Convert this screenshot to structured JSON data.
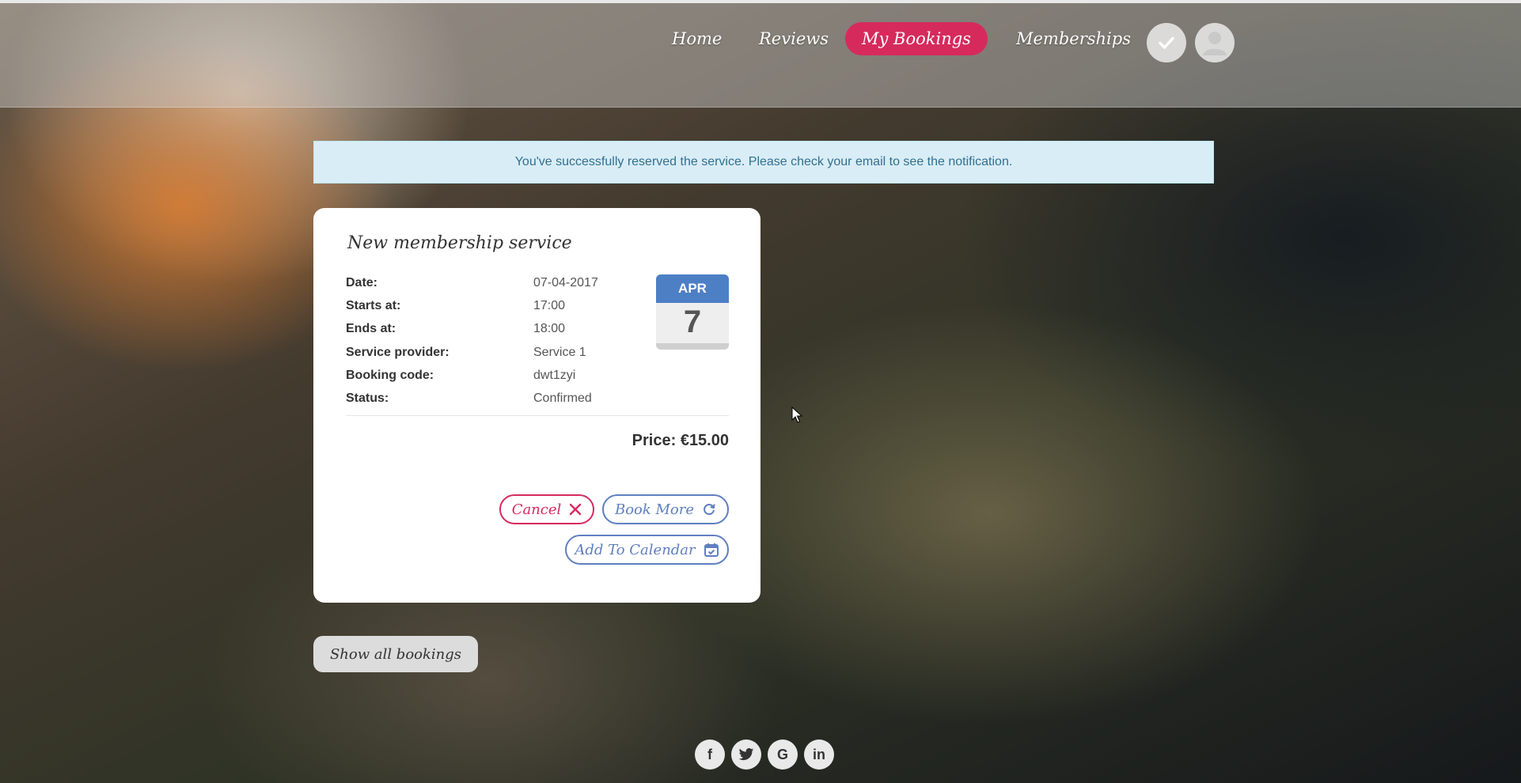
{
  "nav": {
    "home": "Home",
    "reviews": "Reviews",
    "my_bookings": "My Bookings",
    "memberships": "Memberships",
    "check_icon": "check-icon",
    "avatar_icon": "user-avatar-icon"
  },
  "alert": {
    "message": "You've successfully reserved the service. Please check your email to see the notification."
  },
  "booking": {
    "title": "New membership service",
    "fields": [
      {
        "label": "Date:",
        "value": "07-04-2017"
      },
      {
        "label": "Starts at:",
        "value": "17:00"
      },
      {
        "label": "Ends at:",
        "value": "18:00"
      },
      {
        "label": "Service provider:",
        "value": "Service 1"
      },
      {
        "label": "Booking code:",
        "value": "dwt1zyi"
      },
      {
        "label": "Status:",
        "value": "Confirmed"
      }
    ],
    "calendar": {
      "month": "APR",
      "day": "7"
    },
    "price": "Price: €15.00",
    "buttons": {
      "cancel": "Cancel",
      "book_more": "Book More",
      "add_to_calendar": "Add To Calendar"
    }
  },
  "show_all": "Show all bookings",
  "social": {
    "facebook": "f",
    "twitter": "twitter-icon",
    "google": "G",
    "linkedin": "in"
  },
  "colors": {
    "accent": "#d62a5d",
    "secondary": "#5f7fc0",
    "alert_bg": "#d9edf7",
    "alert_text": "#31708f"
  }
}
